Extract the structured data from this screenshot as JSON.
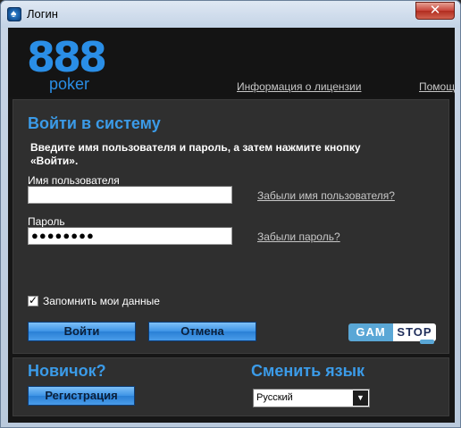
{
  "window": {
    "title": "Логин",
    "close_glyph": "✕"
  },
  "header": {
    "logo_number": "888",
    "logo_word": "poker",
    "license_link": "Информация о лицензии",
    "help_link": "Помощь"
  },
  "login": {
    "title": "Войти в систему",
    "instructions": "Введите имя пользователя и пароль, а затем нажмите кнопку «Войти».",
    "username_label": "Имя пользователя",
    "username_value": "",
    "password_label": "Пароль",
    "password_value": "●●●●●●●●",
    "forgot_username": "Забыли имя пользователя?",
    "forgot_password": "Забыли пароль?",
    "remember_label": "Запомнить мои данные",
    "remember_checked": true,
    "login_button": "Войти",
    "cancel_button": "Отмена",
    "gamstop_left": "GAM",
    "gamstop_right": "STOP"
  },
  "bottom": {
    "new_title": "Новичок?",
    "register_button": "Регистрация",
    "language_title": "Сменить язык",
    "language_selected": "Русский"
  },
  "colors": {
    "accent": "#3b9be8",
    "logo": "#2a8ee6",
    "panel": "#2f2f2f",
    "background": "#161616"
  }
}
